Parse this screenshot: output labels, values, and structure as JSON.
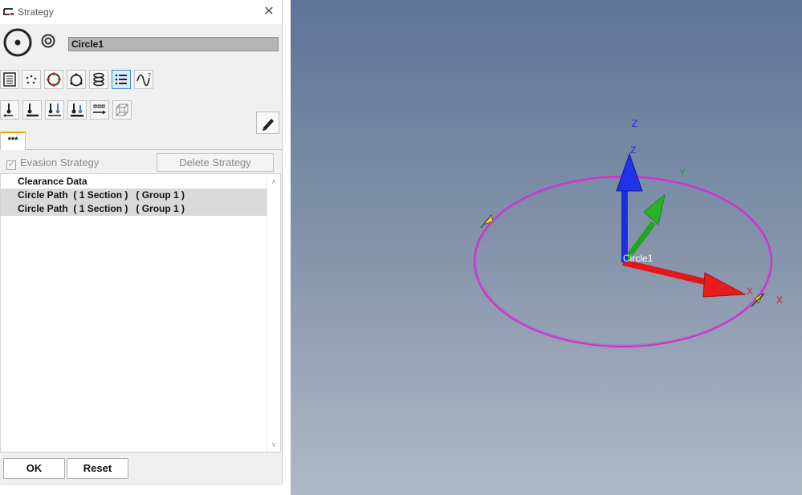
{
  "window": {
    "title": "Strategy",
    "close_glyph": "✕"
  },
  "name_field": {
    "value": "Circle1"
  },
  "toolbar_row1": [
    {
      "icon": "list-view-icon"
    },
    {
      "icon": "points-icon"
    },
    {
      "icon": "circle-target-icon"
    },
    {
      "icon": "circle-points-icon"
    },
    {
      "icon": "stack-icon"
    },
    {
      "icon": "bullet-list-icon",
      "active": true
    },
    {
      "icon": "wave-help-icon"
    }
  ],
  "toolbar_row2": [
    {
      "icon": "probe-left-icon"
    },
    {
      "icon": "probe-right-icon"
    },
    {
      "icon": "probe-double-icon"
    },
    {
      "icon": "probe-shaded-icon"
    },
    {
      "icon": "move-points-icon"
    },
    {
      "icon": "wire-cube-icon"
    }
  ],
  "tab": {
    "label": "***"
  },
  "evasion": {
    "label": "Evasion Strategy",
    "checked": true,
    "enabled": false,
    "check_glyph": "✓"
  },
  "delete_button": {
    "label": "Delete Strategy"
  },
  "list": {
    "items": [
      {
        "label": "Clearance Data",
        "selected": false
      },
      {
        "label": "Circle Path  ( 1 Section )   ( Group 1 )",
        "selected": true
      },
      {
        "label": "Circle Path  ( 1 Section )   ( Group 1 )",
        "selected": true
      }
    ],
    "scroll_up_glyph": "∧",
    "scroll_down_glyph": "∨"
  },
  "footer": {
    "ok_label": "OK",
    "reset_label": "Reset"
  },
  "viewport": {
    "axis_labels": {
      "z_outer": "Z",
      "z": "Z",
      "y": "Y",
      "x": "X",
      "x_outer": "X"
    },
    "feature_label": "Circle1",
    "colors": {
      "circle": "#cc33cc",
      "z_axis": "#1c2ee0",
      "y_axis": "#22a322",
      "x_axis": "#e01818",
      "marker": "#e8d420"
    }
  }
}
